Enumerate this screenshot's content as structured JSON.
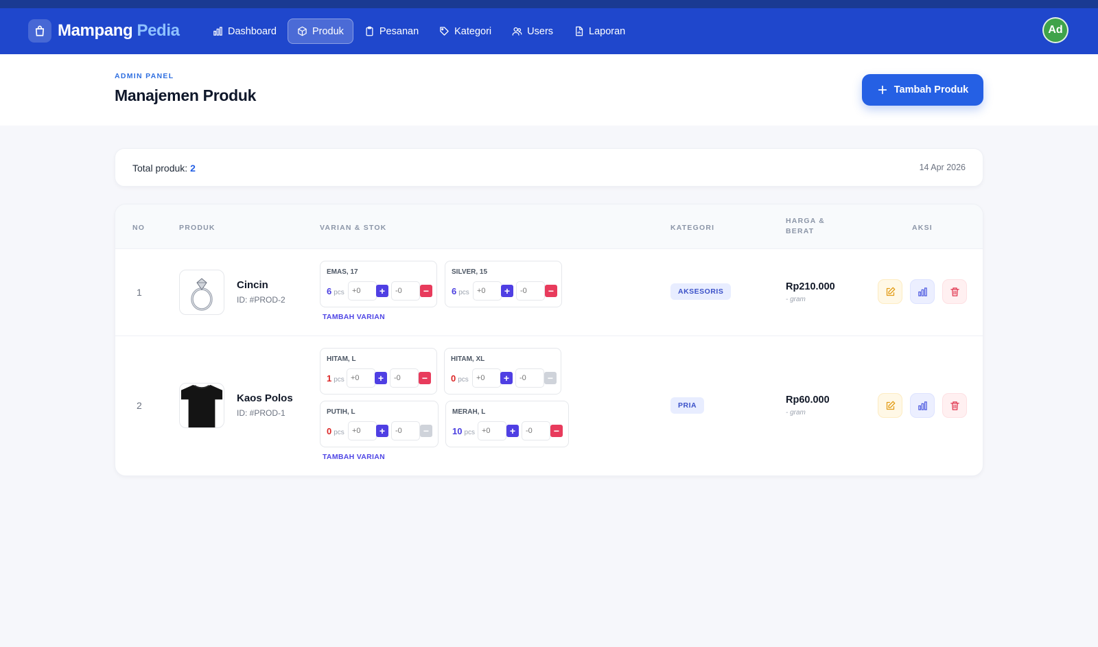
{
  "brand": {
    "name_main": "Mampang",
    "name_accent": "Pedia"
  },
  "nav": [
    {
      "label": "Dashboard",
      "icon": "bar-chart-icon",
      "active": false
    },
    {
      "label": "Produk",
      "icon": "box-icon",
      "active": true
    },
    {
      "label": "Pesanan",
      "icon": "clipboard-icon",
      "active": false
    },
    {
      "label": "Kategori",
      "icon": "tag-icon",
      "active": false
    },
    {
      "label": "Users",
      "icon": "users-icon",
      "active": false
    },
    {
      "label": "Laporan",
      "icon": "report-icon",
      "active": false
    }
  ],
  "user": {
    "initials": "Ad"
  },
  "header": {
    "kicker": "ADMIN PANEL",
    "title": "Manajemen Produk",
    "add_button": "Tambah Produk"
  },
  "summary": {
    "label": "Total produk:",
    "count": "2",
    "date": "14 Apr 2026"
  },
  "table": {
    "columns": [
      "NO",
      "PRODUK",
      "VARIAN & STOK",
      "KATEGORI",
      "HARGA & BERAT",
      "AKSI"
    ],
    "add_variant_label": "TAMBAH VARIAN",
    "rows": [
      {
        "no": "1",
        "name": "Cincin",
        "id": "ID: #PROD-2",
        "image": "ring-image",
        "variants": [
          {
            "label": "EMAS, 17",
            "stock": "6",
            "unit": "pcs",
            "plus_placeholder": "+0",
            "minus_placeholder": "-0"
          },
          {
            "label": "SILVER, 15",
            "stock": "6",
            "unit": "pcs",
            "plus_placeholder": "+0",
            "minus_placeholder": "-0"
          }
        ],
        "category": "AKSESORIS",
        "price": "Rp210.000",
        "weight": "- gram"
      },
      {
        "no": "2",
        "name": "Kaos Polos",
        "id": "ID: #PROD-1",
        "image": "tshirt-image",
        "variants": [
          {
            "label": "HITAM, L",
            "stock": "1",
            "unit": "pcs",
            "plus_placeholder": "+0",
            "minus_placeholder": "-0"
          },
          {
            "label": "HITAM, XL",
            "stock": "0",
            "unit": "pcs",
            "plus_placeholder": "+0",
            "minus_placeholder": "-0"
          },
          {
            "label": "PUTIH, L",
            "stock": "0",
            "unit": "pcs",
            "plus_placeholder": "+0",
            "minus_placeholder": "-0"
          },
          {
            "label": "MERAH, L",
            "stock": "10",
            "unit": "pcs",
            "plus_placeholder": "+0",
            "minus_placeholder": "-0"
          }
        ],
        "category": "PRIA",
        "price": "Rp60.000",
        "weight": "- gram"
      }
    ]
  },
  "colors": {
    "primary": "#1f47cc",
    "accent": "#2560e4",
    "positive_stock": "#4b3fe0",
    "zero_stock": "#dc2626"
  }
}
